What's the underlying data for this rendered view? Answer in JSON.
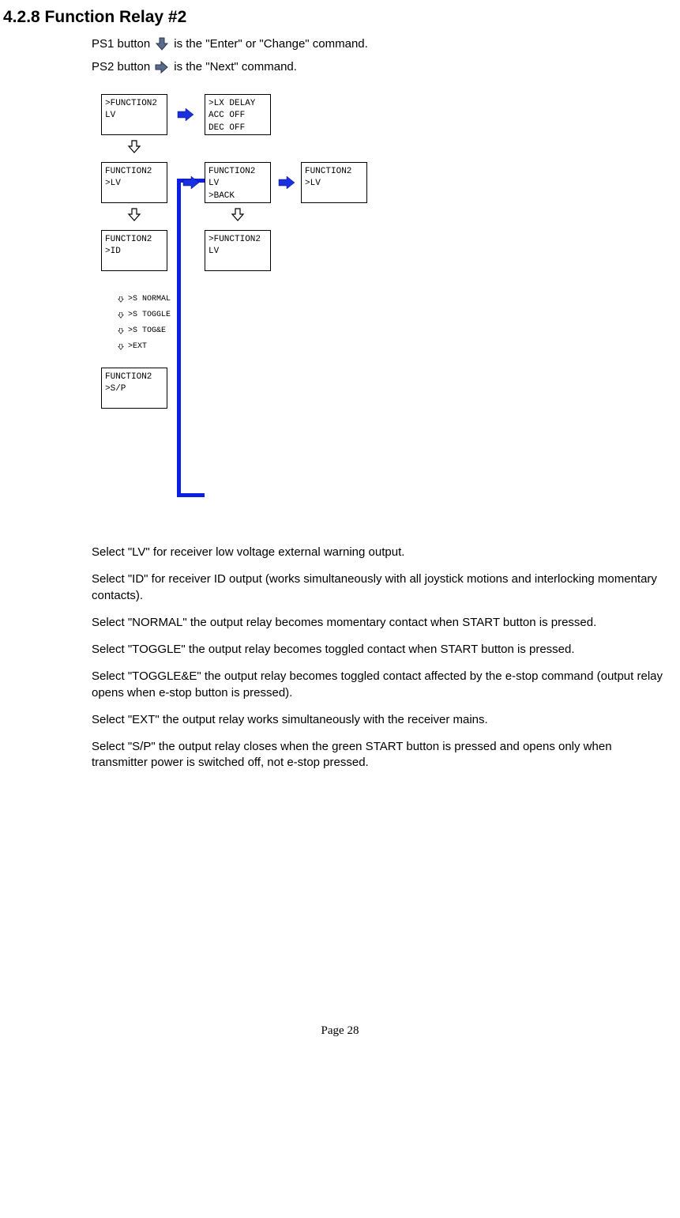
{
  "heading": "4.2.8    Function Relay #2",
  "intro": {
    "ps1_pre": "PS1 button",
    "ps1_post": " is the \"Enter\" or \"Change\" command.",
    "ps2_pre": "PS2 button",
    "ps2_post": " is the \"Next\" command."
  },
  "diagram": {
    "box_a": {
      "l1": ">FUNCTION2",
      "l2": " LV"
    },
    "box_b": {
      "l1": ">LX DELAY",
      "l2": "  ACC OFF",
      "l3": "  DEC OFF"
    },
    "box_c": {
      "l1": " FUNCTION2",
      "l2": ">LV"
    },
    "box_d": {
      "l1": " FUNCTION2",
      "l2": " LV",
      "l3": ">BACK"
    },
    "box_e": {
      "l1": " FUNCTION2",
      "l2": ">LV"
    },
    "box_f": {
      "l1": " FUNCTION2",
      "l2": ">ID"
    },
    "box_g": {
      "l1": ">FUNCTION2",
      "l2": " LV"
    },
    "sub": {
      "r1": ">S  NORMAL",
      "r2": ">S  TOGGLE",
      "r3": ">S  TOG&E",
      "r4": ">EXT"
    },
    "box_h": {
      "l1": " FUNCTION2",
      "l2": ">S/P"
    }
  },
  "paragraphs": {
    "p1": "Select \"LV\" for receiver low voltage external warning output.",
    "p2": "Select \"ID\" for receiver ID output (works simultaneously with all joystick motions and interlocking momentary contacts).",
    "p3": "Select \"NORMAL\" the output relay becomes momentary contact when START button is pressed.",
    "p4": "Select \"TOGGLE\" the output relay becomes toggled contact when START button is pressed.",
    "p5": "Select \"TOGGLE&E\" the output relay becomes toggled contact affected by the e-stop command (output relay opens when e-stop button is pressed).",
    "p6": "Select \"EXT\" the output relay works simultaneously with the receiver mains.",
    "p7": "Select \"S/P\" the output relay closes when the green START button is pressed and opens only when transmitter power is switched off, not e-stop pressed."
  },
  "footer": "Page 28"
}
